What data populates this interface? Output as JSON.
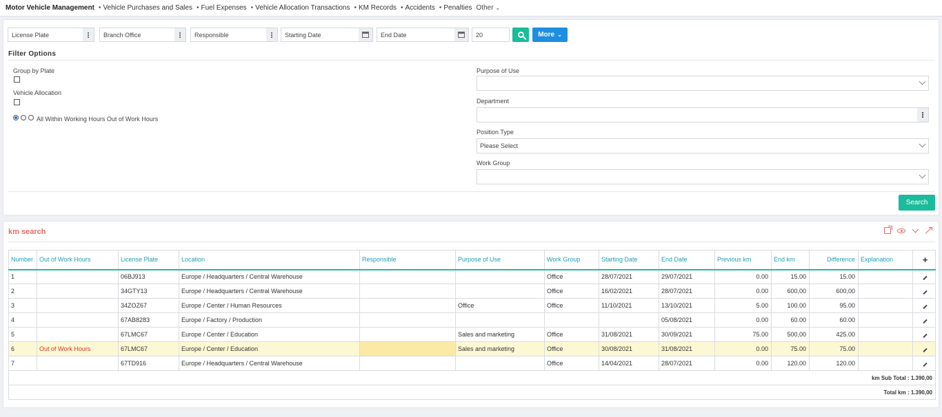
{
  "topnav": {
    "brand": "Motor Vehicle Management",
    "links": [
      "Vehicle Purchases and Sales",
      "Fuel Expenses",
      "Vehicle Allocation Transactions",
      "KM Records",
      "Accidents",
      "Penalties"
    ],
    "other": "Other"
  },
  "filters": {
    "license_plate": "License Plate",
    "branch_office": "Branch Office",
    "responsible": "Responsible",
    "starting_date": "Starting Date",
    "end_date": "End Date",
    "page_size": "20",
    "more": "More"
  },
  "filter_options": {
    "title": "Filter Options",
    "group_by_plate": "Group by Plate",
    "vehicle_allocation": "Vehicle Allocation",
    "hours_radio_label": "All Within Working Hours Out of Work Hours",
    "purpose_of_use": "Purpose of Use",
    "department": "Department",
    "position_type": "Position Type",
    "position_type_value": "Please Select",
    "work_group": "Work Group",
    "search": "Search"
  },
  "results": {
    "title": "km search",
    "columns": [
      "Number",
      "Out of Work Hours",
      "License Plate",
      "Location",
      "Responsible",
      "Purpose of Use",
      "Work Group",
      "Starting Date",
      "End Date",
      "Previous km",
      "End km",
      "Difference",
      "Explanation",
      "+"
    ],
    "rows": [
      {
        "number": "1",
        "ooh": "",
        "plate": "06BJ913",
        "location": "Europe / Headquarters / Central Warehouse",
        "responsible": "",
        "purpose": "",
        "group": "Office",
        "start": "28/07/2021",
        "end": "29/07/2021",
        "prev": "0.00",
        "endkm": "15.00",
        "diff": "15.00",
        "expl": ""
      },
      {
        "number": "2",
        "ooh": "",
        "plate": "34GTY13",
        "location": "Europe / Headquarters / Central Warehouse",
        "responsible": "",
        "purpose": "",
        "group": "Office",
        "start": "16/02/2021",
        "end": "28/07/2021",
        "prev": "0.00",
        "endkm": "600,00",
        "diff": "600,00",
        "expl": ""
      },
      {
        "number": "3",
        "ooh": "",
        "plate": "34ZOZ67",
        "location": "Europe / Center / Human Resources",
        "responsible": "",
        "purpose": "Office",
        "group": "Office",
        "start": "11/10/2021",
        "end": "13/10/2021",
        "prev": "5.00",
        "endkm": "100.00",
        "diff": "95.00",
        "expl": ""
      },
      {
        "number": "4",
        "ooh": "",
        "plate": "67AB8283",
        "location": "Europe / Factory / Production",
        "responsible": "",
        "purpose": "",
        "group": "",
        "start": "",
        "end": "05/08/2021",
        "prev": "0.00",
        "endkm": "60.00",
        "diff": "60.00",
        "expl": ""
      },
      {
        "number": "5",
        "ooh": "",
        "plate": "67LMC67",
        "location": "Europe / Center / Education",
        "responsible": "",
        "purpose": "Sales and marketing",
        "group": "Office",
        "start": "31/08/2021",
        "end": "30/09/2021",
        "prev": "75.00",
        "endkm": "500,00",
        "diff": "425.00",
        "expl": ""
      },
      {
        "number": "6",
        "ooh": "Out of Work Hours",
        "plate": "67LMC67",
        "location": "Europe / Center / Education",
        "responsible": "",
        "purpose": "Sales and marketing",
        "group": "Office",
        "start": "30/08/2021",
        "end": "31/08/2021",
        "prev": "0.00",
        "endkm": "75.00",
        "diff": "75.00",
        "expl": ""
      },
      {
        "number": "7",
        "ooh": "",
        "plate": "67TD916",
        "location": "Europe / Headquarters / Central Warehouse",
        "responsible": "",
        "purpose": "",
        "group": "Office",
        "start": "14/04/2021",
        "end": "28/07/2021",
        "prev": "0.00",
        "endkm": "120.00",
        "diff": "120.00",
        "expl": ""
      }
    ],
    "sub_total": "km Sub Total : 1.390,00",
    "total": "Total km : 1.390,00"
  },
  "colors": {
    "accent": "#1bbc9b",
    "more_button": "#1d8fe0",
    "header_text": "#1b9fb5",
    "panel_title": "#e36b6b",
    "highlight_row": "#fdf8d4"
  }
}
